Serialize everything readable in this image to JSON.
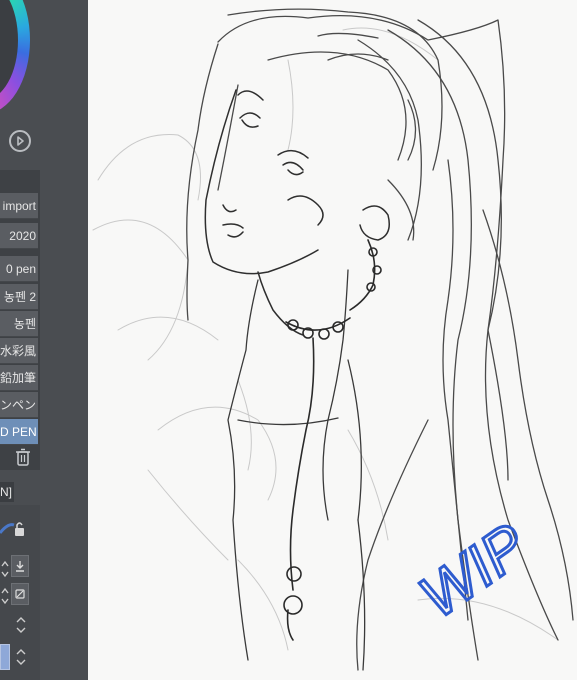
{
  "sidebar": {
    "brushes": [
      {
        "label": "import"
      },
      {
        "label": "2020"
      },
      {
        "label": "0 pen"
      },
      {
        "label": "농펜 2"
      },
      {
        "label": "농펜"
      },
      {
        "label": "水彩風"
      },
      {
        "label": "鉛加筆"
      },
      {
        "label": "ンペン"
      },
      {
        "label": "D PEN",
        "selected": true
      }
    ],
    "tab_label": "N]"
  },
  "canvas": {
    "annotation": "WIP",
    "ink_color": "#2f2f2f",
    "wip_color": "#2e5ccf"
  }
}
